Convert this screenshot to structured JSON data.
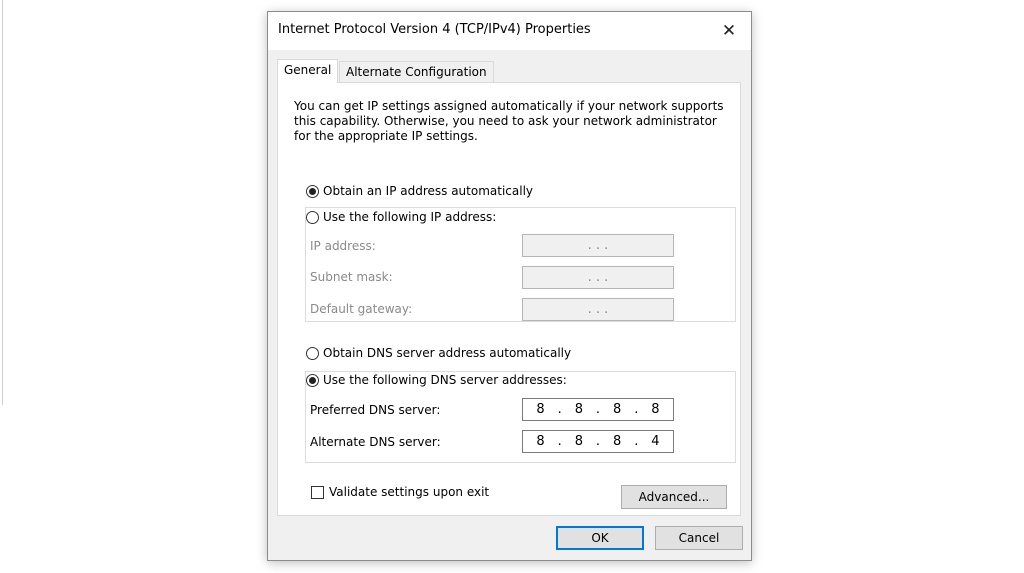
{
  "dialog": {
    "title": "Internet Protocol Version 4 (TCP/IPv4) Properties",
    "close_glyph": "✕"
  },
  "tabs": [
    {
      "label": "General",
      "active": true
    },
    {
      "label": "Alternate Configuration",
      "active": false
    }
  ],
  "general": {
    "description": "You can get IP settings assigned automatically if your network supports this capability. Otherwise, you need to ask your network administrator for the appropriate IP settings.",
    "ip_mode": {
      "auto_label": "Obtain an IP address automatically",
      "manual_label": "Use the following IP address:",
      "selected": "auto"
    },
    "ip_fields": {
      "ip_address": {
        "label": "IP address:",
        "value": ".     .     ."
      },
      "subnet_mask": {
        "label": "Subnet mask:",
        "value": ".     .     ."
      },
      "default_gateway": {
        "label": "Default gateway:",
        "value": ".     .     ."
      }
    },
    "dns_mode": {
      "auto_label": "Obtain DNS server address automatically",
      "manual_label": "Use the following DNS server addresses:",
      "selected": "manual"
    },
    "dns_fields": {
      "preferred": {
        "label": "Preferred DNS server:",
        "octets": [
          "8",
          ".",
          "8",
          ".",
          "8",
          ".",
          "8"
        ]
      },
      "alternate": {
        "label": "Alternate DNS server:",
        "octets": [
          "8",
          ".",
          "8",
          ".",
          "8",
          ".",
          "4"
        ]
      }
    },
    "validate_label": "Validate settings upon exit",
    "validate_checked": false,
    "advanced_label": "Advanced..."
  },
  "buttons": {
    "ok": "OK",
    "cancel": "Cancel"
  },
  "colors": {
    "dialog_bg": "#f0f0f0",
    "default_button_border": "#0078d7",
    "disabled_text": "#8a8a8a"
  }
}
